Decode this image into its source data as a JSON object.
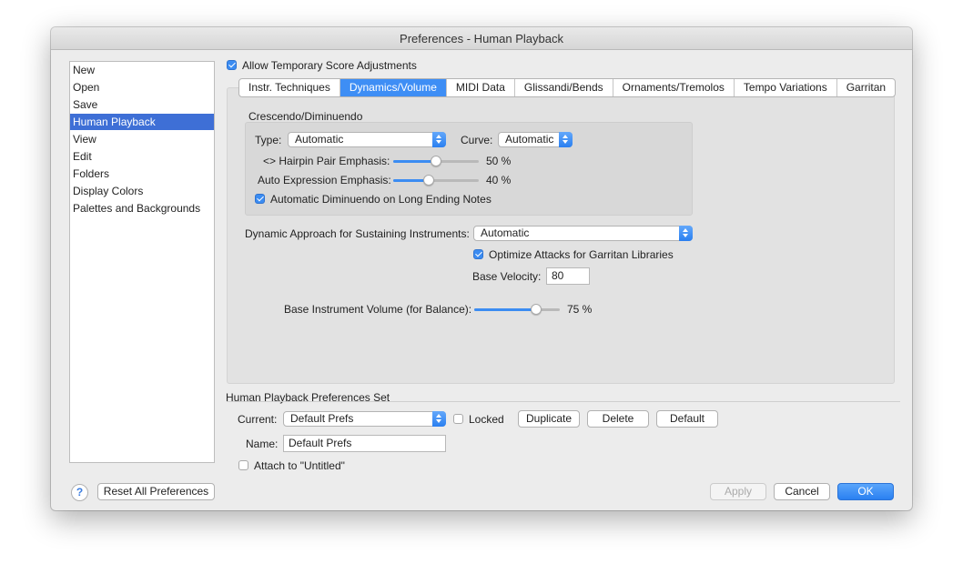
{
  "window": {
    "title": "Preferences - Human Playback"
  },
  "sidebar": {
    "items": [
      {
        "label": "New"
      },
      {
        "label": "Open"
      },
      {
        "label": "Save"
      },
      {
        "label": "Human Playback",
        "selected": true
      },
      {
        "label": "View"
      },
      {
        "label": "Edit"
      },
      {
        "label": "Folders"
      },
      {
        "label": "Display Colors"
      },
      {
        "label": "Palettes and Backgrounds"
      }
    ]
  },
  "allow_temp": {
    "label": "Allow Temporary Score Adjustments",
    "checked": true
  },
  "tabs": [
    {
      "label": "Instr. Techniques"
    },
    {
      "label": "Dynamics/Volume",
      "selected": true
    },
    {
      "label": "MIDI Data"
    },
    {
      "label": "Glissandi/Bends"
    },
    {
      "label": "Ornaments/Tremolos"
    },
    {
      "label": "Tempo Variations"
    },
    {
      "label": "Garritan"
    }
  ],
  "crescendo": {
    "group_label": "Crescendo/Diminuendo",
    "type_label": "Type:",
    "type_value": "Automatic",
    "curve_label": "Curve:",
    "curve_value": "Automatic",
    "hairpin_label": "<> Hairpin Pair Emphasis:",
    "hairpin_value": 50,
    "hairpin_text": "50 %",
    "auto_expr_label": "Auto Expression Emphasis:",
    "auto_expr_value": 40,
    "auto_expr_text": "40 %",
    "auto_dim_label": "Automatic Diminuendo on Long Ending Notes",
    "auto_dim_checked": true
  },
  "sustain": {
    "label": "Dynamic Approach for Sustaining Instruments:",
    "value": "Automatic",
    "optimize_label": "Optimize Attacks for Garritan Libraries",
    "optimize_checked": true,
    "base_velocity_label": "Base Velocity:",
    "base_velocity_value": "80",
    "base_volume_label": "Base Instrument Volume (for Balance):",
    "base_volume_value": 75,
    "base_volume_text": "75 %"
  },
  "prefs_set": {
    "heading": "Human Playback Preferences Set",
    "current_label": "Current:",
    "current_value": "Default Prefs",
    "locked_label": "Locked",
    "locked_checked": false,
    "duplicate_label": "Duplicate",
    "delete_label": "Delete",
    "default_label": "Default",
    "name_label": "Name:",
    "name_value": "Default Prefs",
    "attach_label": "Attach to \"Untitled\"",
    "attach_checked": false
  },
  "footer": {
    "help_label": "?",
    "reset_label": "Reset All Preferences",
    "apply_label": "Apply",
    "cancel_label": "Cancel",
    "ok_label": "OK"
  },
  "colors": {
    "accent": "#3b8cf2",
    "selection": "#3e6fd6"
  }
}
